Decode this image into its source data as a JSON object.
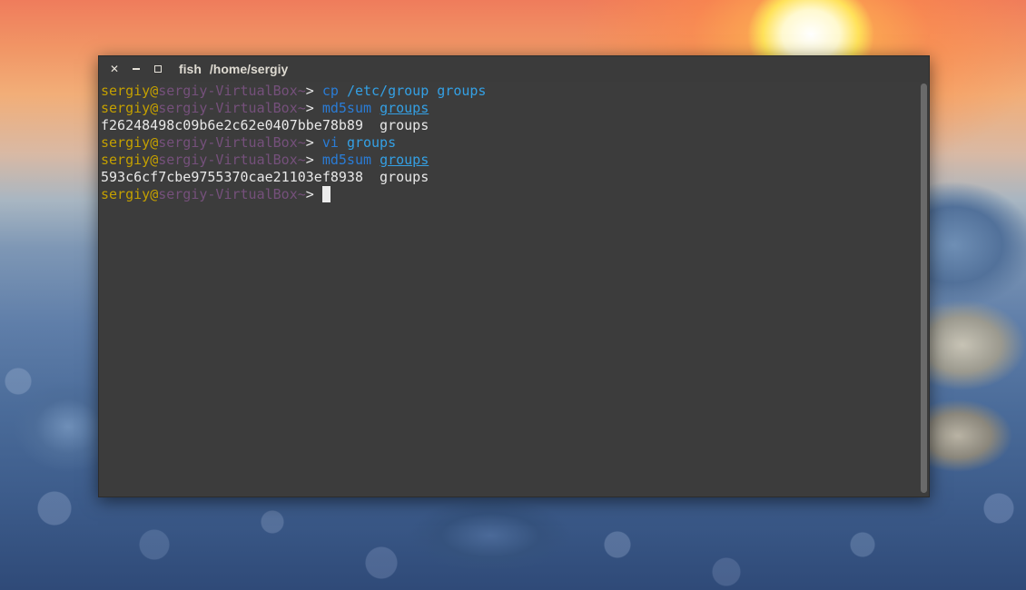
{
  "window": {
    "app_name": "fish",
    "path": "/home/sergiy",
    "close_glyph": "✕"
  },
  "prompt": {
    "user": "sergiy",
    "at": "@",
    "host": "sergiy-VirtualBox",
    "tilde": "~",
    "gt": ">"
  },
  "lines": [
    {
      "cmd": "cp",
      "args": [
        "/etc/group",
        "groups"
      ]
    },
    {
      "cmd": "md5sum",
      "args_underlined": [
        "groups"
      ]
    },
    {
      "output": "f26248498c09b6e2c62e0407bbe78b89  groups"
    },
    {
      "cmd": "vi",
      "args": [
        "groups"
      ]
    },
    {
      "cmd": "md5sum",
      "args_underlined": [
        "groups"
      ]
    },
    {
      "output": "593c6cf7cbe9755370cae21103ef8938  groups"
    }
  ],
  "colors": {
    "user": "#c4a000",
    "host": "#75507b",
    "command": "#2a7cd6",
    "argument": "#34a0e4",
    "terminal_bg": "#3c3c3c"
  }
}
